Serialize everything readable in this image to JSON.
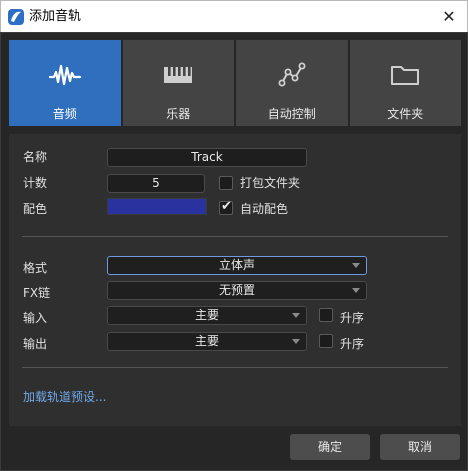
{
  "window": {
    "title": "添加音轨",
    "close_glyph": "✕"
  },
  "tabs": [
    {
      "label": "音频",
      "icon": "audio-wave-icon",
      "active": true
    },
    {
      "label": "乐器",
      "icon": "keyboard-icon",
      "active": false
    },
    {
      "label": "自动控制",
      "icon": "automation-icon",
      "active": false
    },
    {
      "label": "文件夹",
      "icon": "folder-icon",
      "active": false
    }
  ],
  "form": {
    "name_label": "名称",
    "name_value": "Track",
    "count_label": "计数",
    "count_value": "5",
    "pack_folder_label": "打包文件夹",
    "pack_folder_checked": false,
    "color_label": "配色",
    "color_value": "#2a32a0",
    "auto_color_label": "自动配色",
    "auto_color_checked": true,
    "format_label": "格式",
    "format_value": "立体声",
    "fx_label": "FX链",
    "fx_value": "无预置",
    "input_label": "输入",
    "input_value": "主要",
    "input_ascending_label": "升序",
    "input_ascending_checked": false,
    "output_label": "输出",
    "output_value": "主要",
    "output_ascending_label": "升序",
    "output_ascending_checked": false,
    "load_preset_link": "加载轨道预设..."
  },
  "buttons": {
    "ok": "确定",
    "cancel": "取消"
  },
  "colors": {
    "accent": "#2f6fbd",
    "tab_inactive": "#444444",
    "link": "#6fa8e8"
  }
}
